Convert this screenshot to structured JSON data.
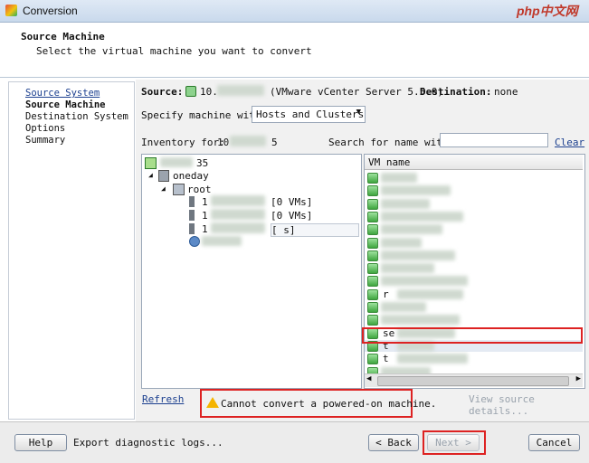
{
  "window": {
    "title": "Conversion"
  },
  "watermark": "php中文网",
  "header": {
    "title": "Source Machine",
    "subtitle": "Select the virtual machine you want to convert"
  },
  "steps": [
    "Source System",
    "Source Machine",
    "Destination System",
    "Options",
    "Summary"
  ],
  "source_info": {
    "source_label": "Source:",
    "source_value": "10.",
    "source_type": "(VMware vCenter Server 5.5.0)",
    "destination_label": "Destination:",
    "destination_value": "none"
  },
  "specify": {
    "label": "Specify machine with:",
    "selected": "Hosts and Clusters"
  },
  "inventory": {
    "label": "Inventory for:",
    "value_start": "10",
    "value_end": "5",
    "search_label": "Search for name with:",
    "search_value": "",
    "clear_label": "Clear"
  },
  "tree": {
    "root": "35",
    "datacenter": "oneday",
    "cluster": "root",
    "hosts": [
      {
        "name": "1",
        "count": "[0 VMs]"
      },
      {
        "name": "1",
        "count": "[0 VMs]"
      },
      {
        "name": "1",
        "count": "[ s]"
      }
    ]
  },
  "vm_list": {
    "column_header": "VM name",
    "rows": [
      "",
      "",
      "",
      "",
      "",
      "",
      "",
      "",
      "",
      "r",
      "",
      "",
      "se",
      "t",
      "t",
      ""
    ],
    "selected_index": 13
  },
  "refresh_label": "Refresh",
  "error": {
    "message": "Cannot convert a powered-on machine.",
    "severity_color": "#f5b400"
  },
  "view_details_label": "View source details...",
  "footer": {
    "help_label": "Help",
    "export_label": "Export diagnostic logs...",
    "back_label": "< Back",
    "next_label": "Next >",
    "cancel_label": "Cancel"
  },
  "colors": {
    "highlight": "#d22222",
    "link": "#1b3f8f"
  }
}
